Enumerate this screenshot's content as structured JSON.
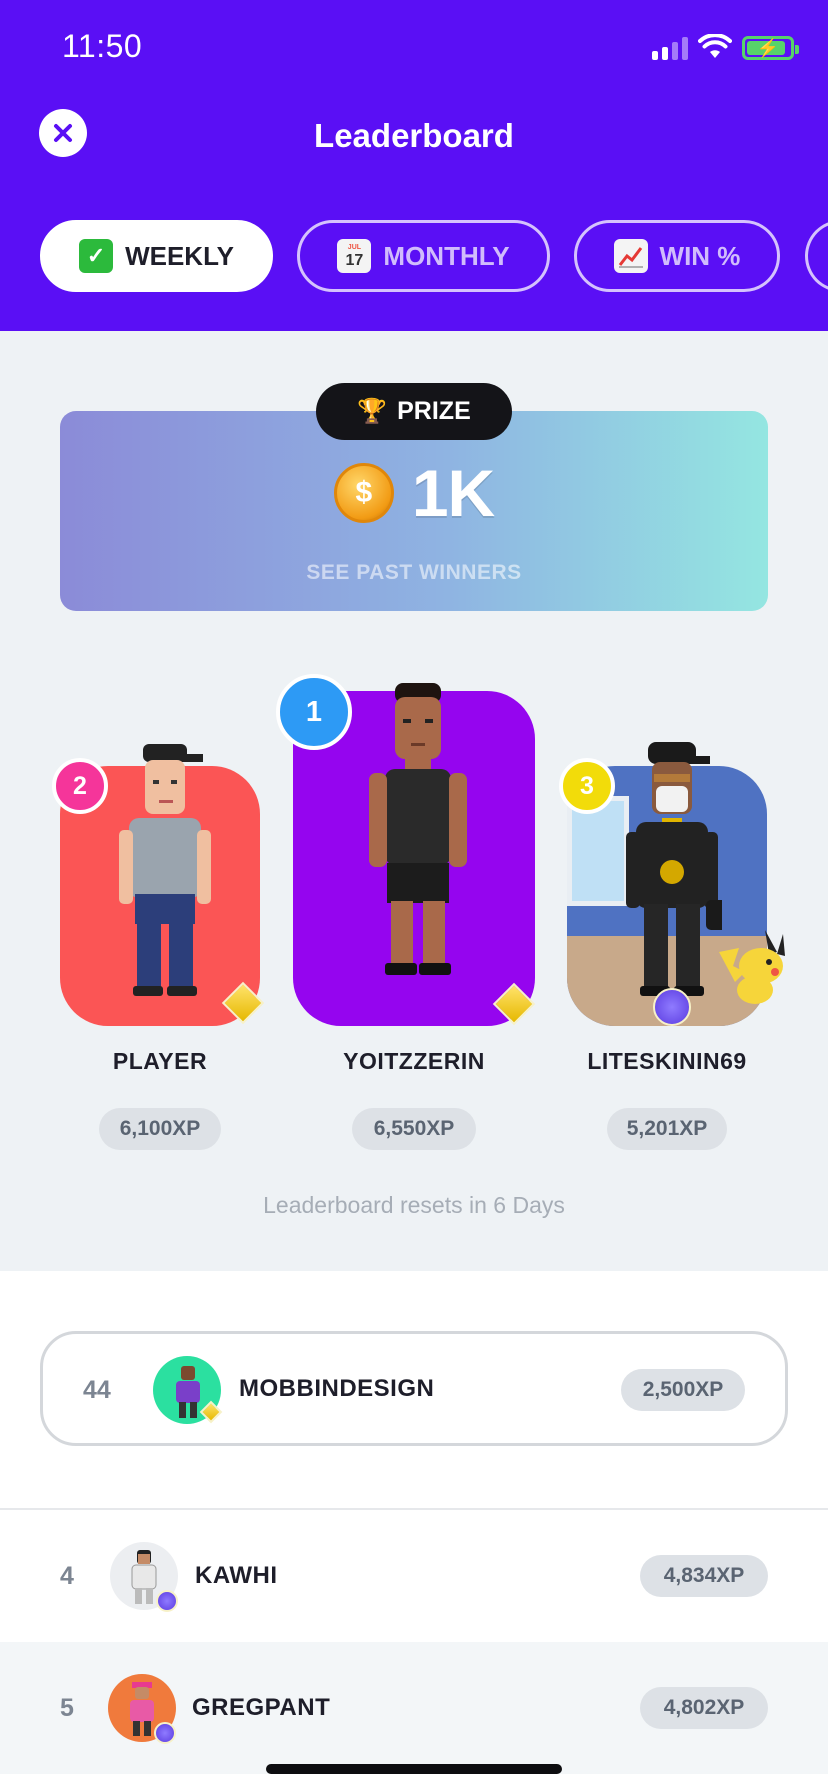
{
  "status_bar": {
    "time": "11:50"
  },
  "header": {
    "title": "Leaderboard"
  },
  "tabs": [
    {
      "label": "WEEKLY",
      "icon": "check-mark-icon",
      "active": true
    },
    {
      "label": "MONTHLY",
      "icon": "calendar-icon",
      "active": false
    },
    {
      "label": "WIN %",
      "icon": "chart-increasing-icon",
      "active": false
    }
  ],
  "calendar_icon": {
    "month": "JUL",
    "day": "17"
  },
  "prize": {
    "pill_label": "PRIZE",
    "amount": "1K",
    "coin_symbol": "$",
    "link": "SEE PAST WINNERS"
  },
  "podium": [
    {
      "rank": "2",
      "name": "PLAYER",
      "xp": "6,100XP",
      "card_color": "#fb5555",
      "badge_color": "#f5359a"
    },
    {
      "rank": "1",
      "name": "YOITZZERIN",
      "xp": "6,550XP",
      "card_color": "#9505ef",
      "badge_color": "#2d9af5"
    },
    {
      "rank": "3",
      "name": "LITESKININ69",
      "xp": "5,201XP",
      "card_color": "#4f72c2",
      "badge_color": "#f2dc0a"
    }
  ],
  "reset_text": "Leaderboard resets in 6 Days",
  "my_position": {
    "rank": "44",
    "name": "MOBBINDESIGN",
    "xp": "2,500XP"
  },
  "rows": [
    {
      "rank": "4",
      "name": "KAWHI",
      "xp": "4,834XP"
    },
    {
      "rank": "5",
      "name": "GREGPANT",
      "xp": "4,802XP"
    }
  ],
  "colors": {
    "header": "#5a0ff5",
    "accent_gem": "#e6b800"
  }
}
